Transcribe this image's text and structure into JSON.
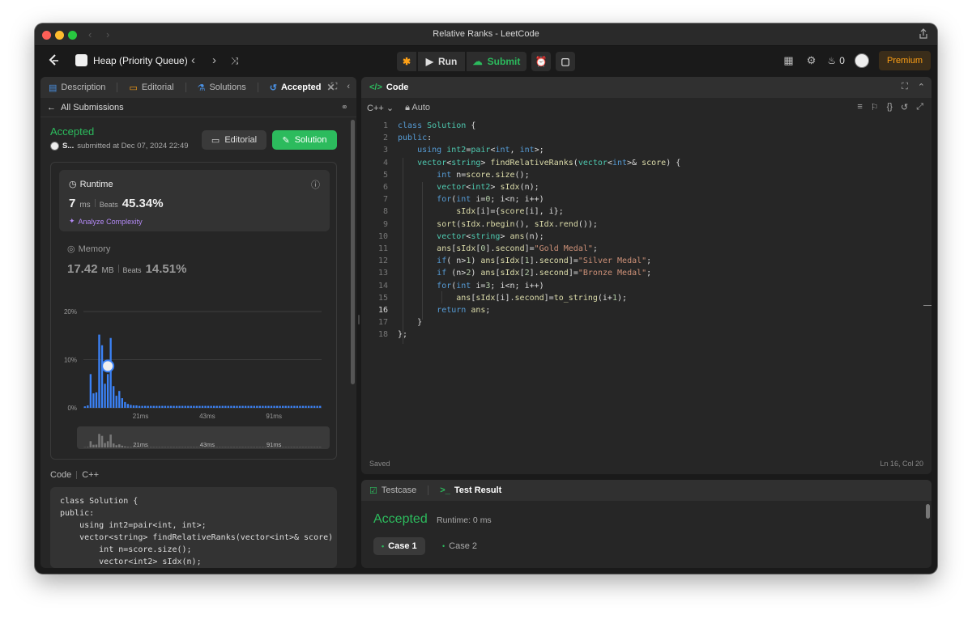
{
  "window": {
    "title": "Relative Ranks - LeetCode"
  },
  "toolbar": {
    "topic": "Heap (Priority Queue)",
    "run_label": "Run",
    "submit_label": "Submit",
    "streak_count": "0",
    "premium_label": "Premium"
  },
  "left_tabs": [
    {
      "label": "Description",
      "icon": "description-icon"
    },
    {
      "label": "Editorial",
      "icon": "book-icon"
    },
    {
      "label": "Solutions",
      "icon": "flask-icon"
    },
    {
      "label": "Accepted",
      "icon": "history-icon"
    }
  ],
  "submission": {
    "back_label": "All Submissions",
    "status": "Accepted",
    "user": "S...",
    "submitted_text": "submitted at Dec 07, 2024 22:49",
    "editorial_btn": "Editorial",
    "solution_btn": "Solution",
    "runtime_label": "Runtime",
    "runtime_value": "7",
    "runtime_unit": "ms",
    "runtime_beats_label": "Beats",
    "runtime_beats": "45.34%",
    "analyze_label": "Analyze Complexity",
    "memory_label": "Memory",
    "memory_value": "17.42",
    "memory_unit": "MB",
    "memory_beats_label": "Beats",
    "memory_beats": "14.51%",
    "code_label": "Code",
    "code_lang": "C++",
    "code_preview": "class Solution {\npublic:\n    using int2=pair<int, int>;\n    vector<string> findRelativeRanks(vector<int>& score)\n        int n=score.size();\n        vector<int2> sIdx(n);\n        for(int i=0; i<n; i++)"
  },
  "chart_data": {
    "type": "bar",
    "title": "",
    "xlabel": "",
    "ylabel": "",
    "ylim": [
      0,
      20
    ],
    "yticks": [
      "20%",
      "10%",
      "0%"
    ],
    "xticks": [
      "21ms",
      "43ms",
      "91ms"
    ],
    "highlight_index": 8,
    "values": [
      0.3,
      0.5,
      7,
      3,
      3.2,
      15.2,
      13,
      5,
      7,
      14.5,
      4.5,
      2.5,
      3.5,
      2,
      1.2,
      0.8,
      0.6,
      0.5,
      0.5,
      0.4,
      0.4,
      0.4,
      0.4,
      0.4,
      0.4,
      0.4,
      0.4,
      0.4,
      0.4,
      0.4,
      0.4,
      0.4,
      0.4,
      0.4,
      0.4,
      0.4,
      0.4,
      0.4,
      0.4,
      0.4,
      0.4,
      0.4,
      0.4,
      0.4,
      0.4,
      0.4,
      0.4,
      0.4,
      0.4,
      0.4,
      0.4,
      0.4,
      0.4,
      0.4,
      0.4,
      0.4,
      0.4,
      0.4,
      0.4,
      0.4,
      0.4,
      0.4,
      0.4,
      0.4,
      0.4,
      0.4,
      0.4,
      0.4,
      0.4,
      0.4,
      0.4,
      0.4,
      0.4,
      0.4,
      0.4,
      0.4,
      0.4,
      0.4,
      0.4,
      0.4,
      0.4,
      0.4,
      0.4
    ],
    "bar_color": "#3b82f6",
    "highlight_color": "#3b82f6"
  },
  "code_panel": {
    "title": "Code",
    "language": "C++",
    "mode": "Auto",
    "saved": "Saved",
    "cursor": "Ln 16, Col 20",
    "lines": [
      "class Solution {",
      "public:",
      "    using int2=pair<int, int>;",
      "    vector<string> findRelativeRanks(vector<int>& score) {",
      "        int n=score.size();",
      "        vector<int2> sIdx(n);",
      "        for(int i=0; i<n; i++)",
      "            sIdx[i]={score[i], i};",
      "        sort(sIdx.rbegin(), sIdx.rend());",
      "        vector<string> ans(n);",
      "        ans[sIdx[0].second]=\"Gold Medal\";",
      "        if( n>1) ans[sIdx[1].second]=\"Silver Medal\";",
      "        if (n>2) ans[sIdx[2].second]=\"Bronze Medal\";",
      "        for(int i=3; i<n; i++)",
      "            ans[sIdx[i].second]=to_string(i+1);",
      "        return ans;",
      "    }",
      "};"
    ],
    "current_line": 16
  },
  "test_panel": {
    "tab_testcase": "Testcase",
    "tab_result": "Test Result",
    "status": "Accepted",
    "runtime": "Runtime: 0 ms",
    "cases": [
      "Case 1",
      "Case 2"
    ]
  }
}
